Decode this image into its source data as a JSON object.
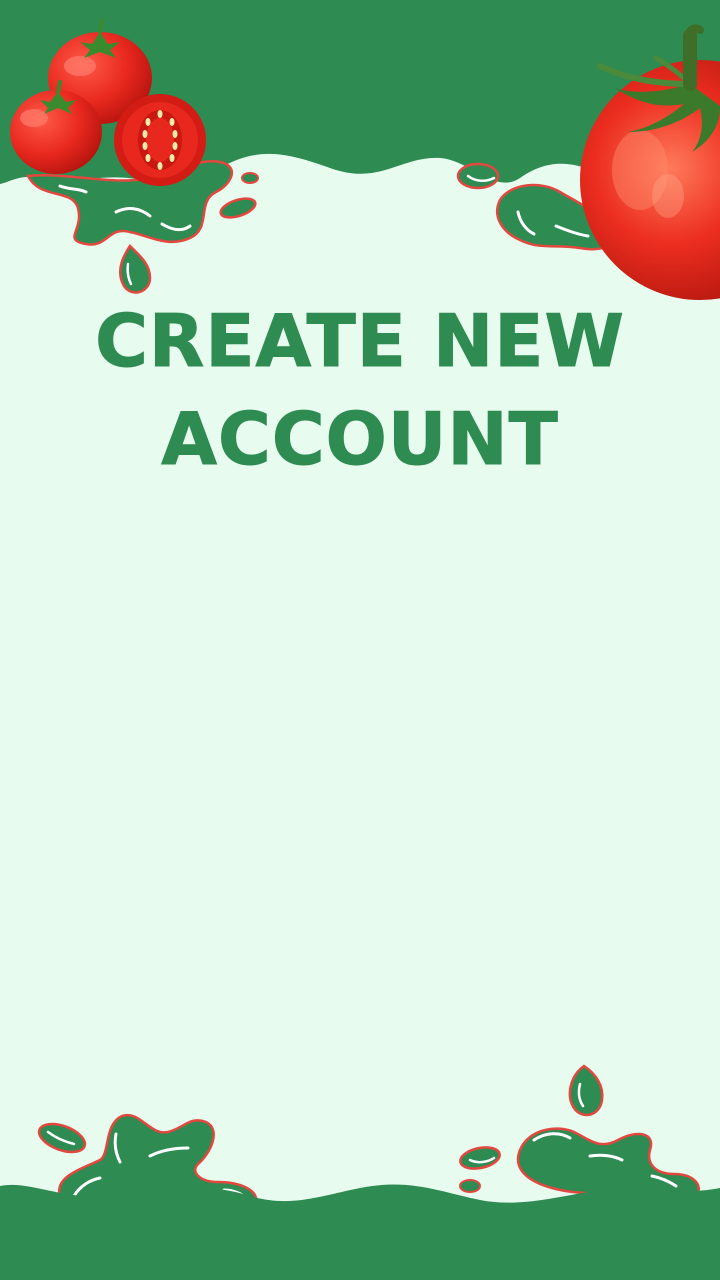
{
  "screen": {
    "title_line_1": "CREATE NEW",
    "title_line_2": "ACCOUNT"
  },
  "decorations": {
    "top_left_icon": "tomato-group-icon",
    "top_right_icon": "tomato-icon",
    "splash_icon": "splash-icon"
  },
  "colors": {
    "background": "#e7fbee",
    "primary_green": "#2e8b52",
    "tomato_red": "#e8281e",
    "splash_outline": "#e2483f"
  }
}
